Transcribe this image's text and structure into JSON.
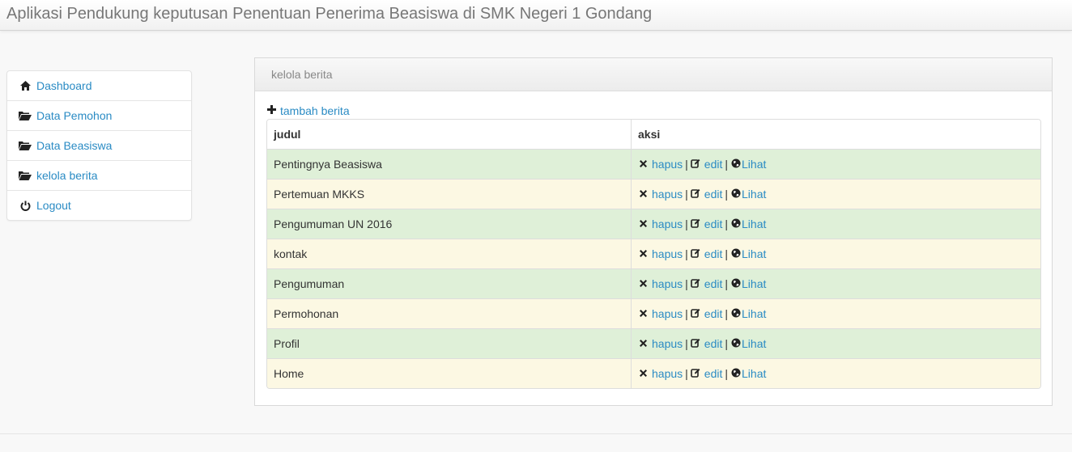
{
  "app": {
    "title": "Aplikasi Pendukung keputusan Penentuan Penerima Beasiswa di SMK Negeri 1 Gondang"
  },
  "sidebar": {
    "items": [
      {
        "label": "Dashboard",
        "icon": "home-icon"
      },
      {
        "label": "Data Pemohon",
        "icon": "folder-open-icon"
      },
      {
        "label": "Data Beasiswa",
        "icon": "folder-open-icon"
      },
      {
        "label": "kelola berita",
        "icon": "folder-open-icon"
      },
      {
        "label": "Logout",
        "icon": "power-icon"
      }
    ]
  },
  "panel": {
    "title": "kelola berita",
    "add_label": "tambah berita",
    "columns": [
      "judul",
      "aksi"
    ],
    "actions": {
      "delete": "hapus",
      "edit": "edit",
      "view": "Lihat",
      "separator": "|"
    },
    "rows": [
      {
        "judul": "Pentingnya Beasiswa"
      },
      {
        "judul": "Pertemuan MKKS"
      },
      {
        "judul": "Pengumuman UN 2016"
      },
      {
        "judul": "kontak"
      },
      {
        "judul": "Pengumuman"
      },
      {
        "judul": "Permohonan"
      },
      {
        "judul": "Profil"
      },
      {
        "judul": "Home"
      }
    ]
  },
  "colors": {
    "link": "#2a8bc4",
    "row_success": "#dff0d8",
    "row_warning": "#fcf8e3"
  }
}
